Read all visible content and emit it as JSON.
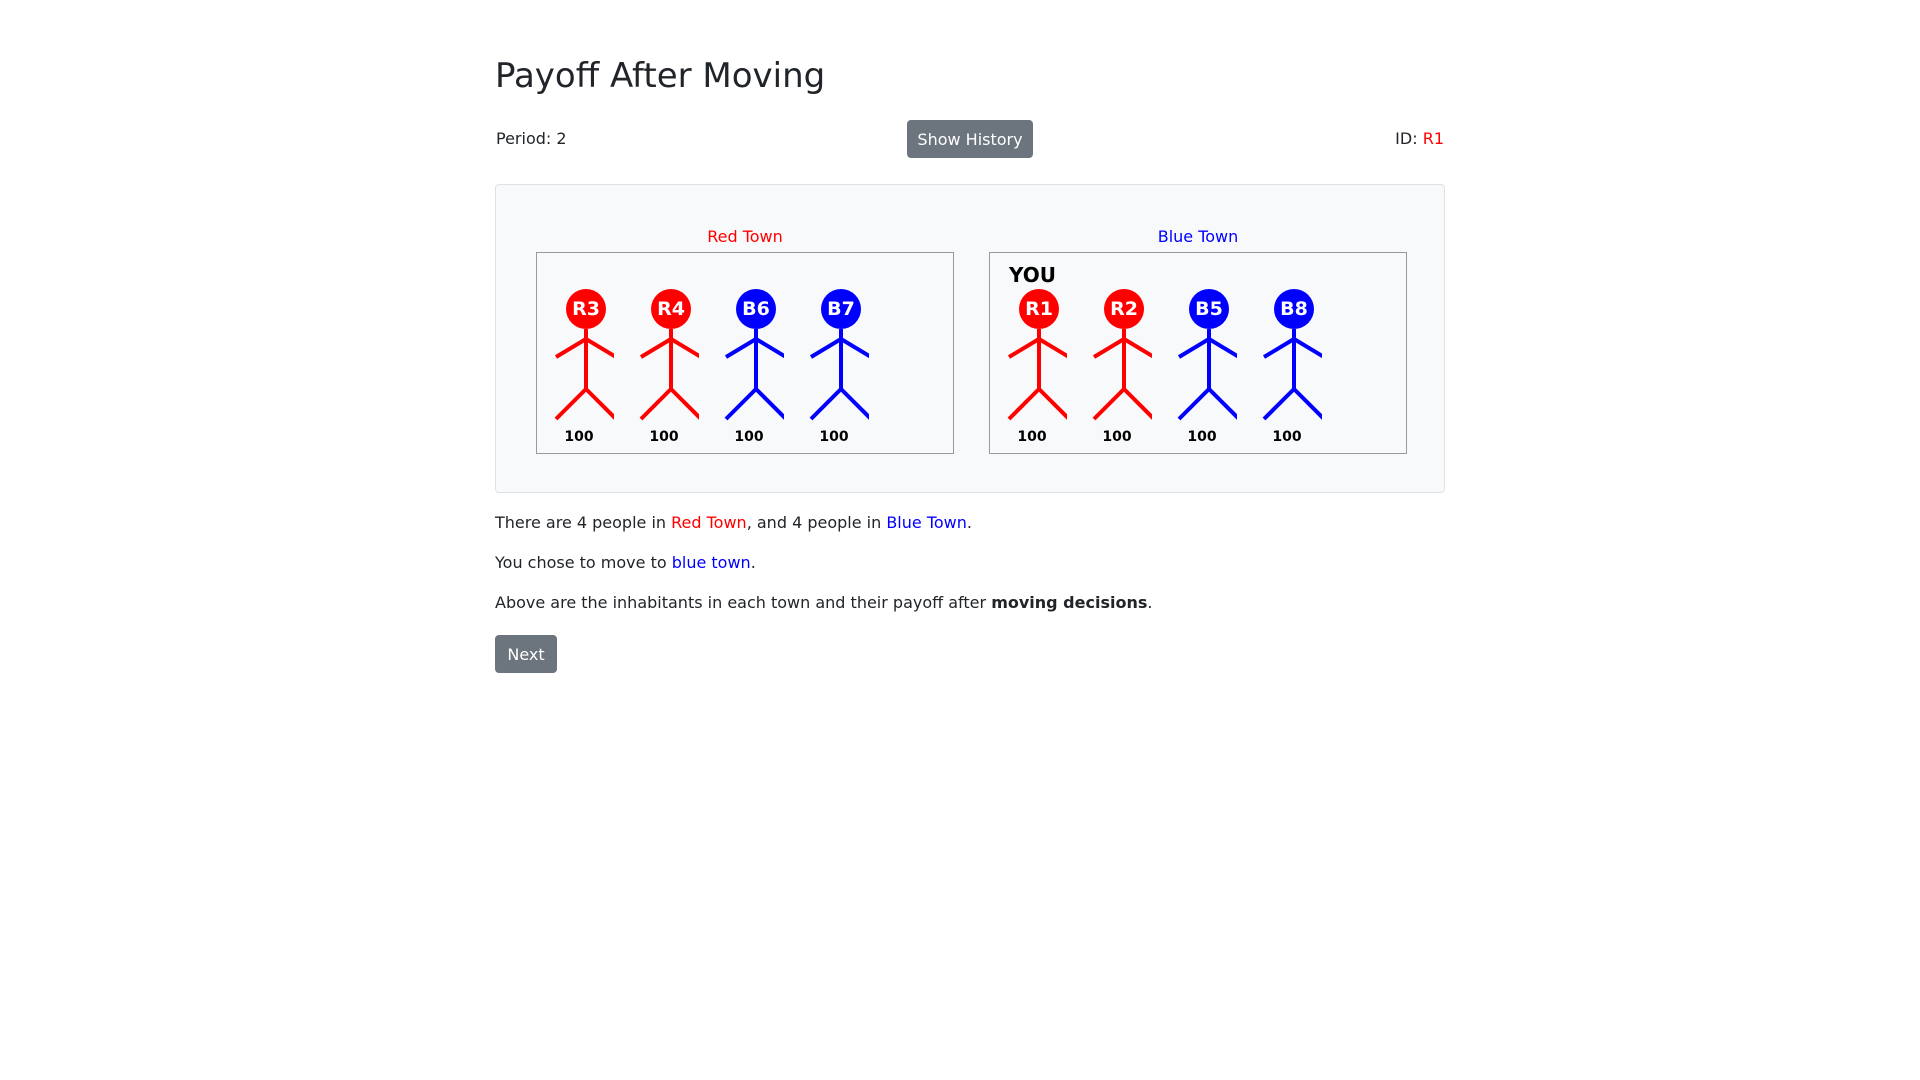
{
  "page": {
    "title": "Payoff After Moving"
  },
  "header": {
    "period_label": "Period:",
    "period_value": "2",
    "history_button": "Show History",
    "id_label": "ID:",
    "id_value": "R1"
  },
  "colors": {
    "red": "#ff0000",
    "blue": "#0000ff",
    "button_gray": "#6c757d"
  },
  "towns": [
    {
      "name": "Red Town",
      "color": "#ff0000",
      "you_label": "",
      "people": [
        {
          "id": "R3",
          "color": "#ff0000",
          "payoff": "100"
        },
        {
          "id": "R4",
          "color": "#ff0000",
          "payoff": "100"
        },
        {
          "id": "B6",
          "color": "#0000ff",
          "payoff": "100"
        },
        {
          "id": "B7",
          "color": "#0000ff",
          "payoff": "100"
        }
      ]
    },
    {
      "name": "Blue Town",
      "color": "#0000ff",
      "you_label": "YOU",
      "people": [
        {
          "id": "R1",
          "color": "#ff0000",
          "payoff": "100"
        },
        {
          "id": "R2",
          "color": "#ff0000",
          "payoff": "100"
        },
        {
          "id": "B5",
          "color": "#0000ff",
          "payoff": "100"
        },
        {
          "id": "B8",
          "color": "#0000ff",
          "payoff": "100"
        }
      ]
    }
  ],
  "summary": {
    "line1": {
      "p1": "There are 4 people in ",
      "red_town": "Red Town",
      "p2": ", and 4 people in ",
      "blue_town": "Blue Town",
      "p3": "."
    },
    "line2": {
      "p1": "You chose to move to ",
      "town": "blue town",
      "p2": "."
    },
    "line3": {
      "p1": "Above are the inhabitants in each town and their payoff after ",
      "bold": "moving decisions",
      "p2": "."
    }
  },
  "next_button": "Next"
}
